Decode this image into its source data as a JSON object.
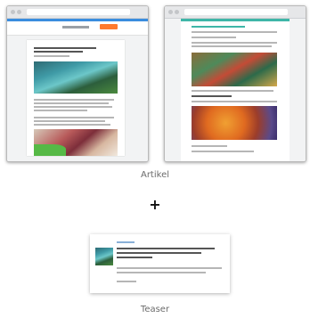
{
  "captions": {
    "article": "Artikel",
    "plus": "+",
    "teaser": "Teaser"
  },
  "colors": {
    "accent_blue": "#3a8dde",
    "accent_orange": "#ff7a2d",
    "accent_teal": "#3fb6a8"
  },
  "thumbnails": [
    {
      "kind": "article-page-screenshot",
      "images": [
        "pool-photo",
        "children-photo"
      ]
    },
    {
      "kind": "article-page-screenshot",
      "images": [
        "food-photo",
        "autumn-leaves-photo"
      ]
    },
    {
      "kind": "teaser-card",
      "images": [
        "pool-thumbnail"
      ]
    }
  ]
}
